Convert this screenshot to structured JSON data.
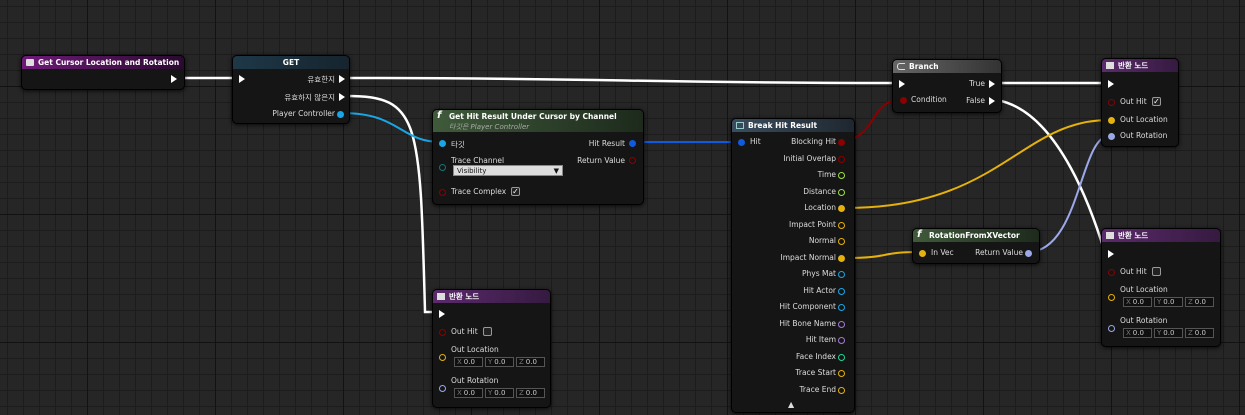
{
  "graph": {
    "background": "#262626"
  },
  "colors": {
    "exec": "#ffffff",
    "bool": "#8b0000",
    "struct_hit": "#0e5ae0",
    "vector": "#e5b10c",
    "rotator": "#9ba8ea",
    "object": "#1aa6e6",
    "name": "#a47ad8",
    "int": "#20d59c",
    "float": "#9ee046",
    "enum": "#0a5b5b"
  },
  "nodes": {
    "get_cursor": {
      "title": "Get Cursor Location and Rotation"
    },
    "get": {
      "title": "GET",
      "out_valid": "유효한지",
      "out_invalid": "유효하지 않은지",
      "in_player_controller": "Player Controller"
    },
    "hit_result": {
      "title": "Get Hit Result Under Cursor by Channel",
      "subtitle": "타깃은 Player Controller",
      "in_target": "타깃",
      "in_trace_channel": "Trace Channel",
      "trace_channel_value": "Visibility",
      "in_trace_complex": "Trace Complex",
      "out_hit_result": "Hit Result",
      "out_return_value": "Return Value"
    },
    "break_hit": {
      "title": "Break Hit Result",
      "in_hit": "Hit",
      "outputs": [
        "Blocking Hit",
        "Initial Overlap",
        "Time",
        "Distance",
        "Location",
        "Impact Point",
        "Normal",
        "Impact Normal",
        "Phys Mat",
        "Hit Actor",
        "Hit Component",
        "Hit Bone Name",
        "Hit Item",
        "Face Index",
        "Trace Start",
        "Trace End"
      ],
      "more_arrow": "▲"
    },
    "branch": {
      "title": "Branch",
      "in_condition": "Condition",
      "out_true": "True",
      "out_false": "False"
    },
    "rot_from_x": {
      "title": "RotationFromXVector",
      "in_vec": "In Vec",
      "out_return": "Return Value"
    },
    "return_top": {
      "title": "반환 노드",
      "out_hit": "Out Hit",
      "out_location": "Out Location",
      "out_rotation": "Out Rotation"
    },
    "return_mid": {
      "title": "반환 노드",
      "out_hit": "Out Hit",
      "out_location": "Out Location",
      "out_rotation": "Out Rotation",
      "loc": {
        "x": "0.0",
        "y": "0.0",
        "z": "0.0"
      },
      "rot": {
        "x": "0.0",
        "y": "0.0",
        "z": "0.0"
      }
    },
    "return_bottom": {
      "title": "반환 노드",
      "out_hit": "Out Hit",
      "out_location": "Out Location",
      "out_rotation": "Out Rotation",
      "loc": {
        "x": "0.0",
        "y": "0.0",
        "z": "0.0"
      },
      "rot": {
        "x": "0.0",
        "y": "0.0",
        "z": "0.0"
      }
    }
  },
  "axes": {
    "x": "X",
    "y": "Y",
    "z": "Z"
  },
  "icons": {
    "function": "f",
    "return": "return-node-icon",
    "branch": "branch-icon",
    "break": "break-struct-icon",
    "check": "✓"
  }
}
